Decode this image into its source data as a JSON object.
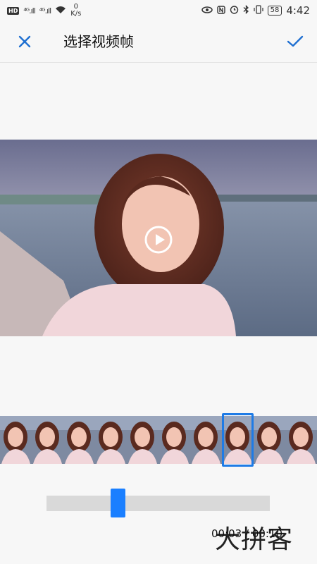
{
  "status_bar": {
    "hd_badge": "HD",
    "net_speed_value": "0",
    "net_speed_unit": "K/s",
    "signal_1": "⁴ᴳ.ıll",
    "signal_2": "⁴ᴳ.ıll",
    "battery": "58",
    "time": "4:42"
  },
  "header": {
    "title": "选择视频帧",
    "close_icon": "close-icon",
    "confirm_icon": "check-icon"
  },
  "video": {
    "play_icon": "play-icon"
  },
  "filmstrip": {
    "frame_count": 10,
    "selected_index": 7
  },
  "slider": {
    "position_fraction": 0.31
  },
  "time_readout": "00:03 / 00:10",
  "watermark": "大拼客",
  "colors": {
    "accent": "#1a7fff",
    "selection_border": "#1e7be6",
    "track": "#d9d9d9",
    "background": "#f7f7f7"
  }
}
